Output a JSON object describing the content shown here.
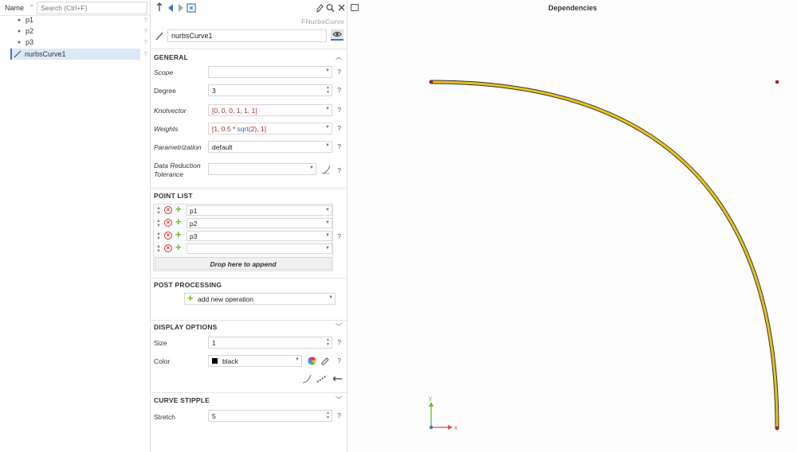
{
  "tree": {
    "name_header": "Name",
    "search_placeholder": "Search (Ctrl+F)",
    "items": [
      {
        "label": "p1",
        "help": "?"
      },
      {
        "label": "p2",
        "help": "?"
      },
      {
        "label": "p3",
        "help": "?"
      },
      {
        "label": "nurbsCurve1",
        "help": "?"
      }
    ]
  },
  "properties": {
    "class_name": "FNurbsCurve",
    "object_name": "nurbsCurve1",
    "general": {
      "title": "GENERAL",
      "scope_label": "Scope",
      "scope_value": "",
      "degree_label": "Degree",
      "degree_value": "3",
      "knotvector_label": "Knotvector",
      "knotvector_value": "[0, 0, 0, 1, 1, 1]",
      "weights_label": "Weights",
      "weights_prefix": "[1, 0.5 * ",
      "weights_fn": "sqrt",
      "weights_suffix": "(2), 1]",
      "param_label": "Parametrization",
      "param_value": "default",
      "tol_label_1": "Data Reduction",
      "tol_label_2": "Tolerance",
      "tol_value": ""
    },
    "point_list": {
      "title": "POINT LIST",
      "items": [
        "p1",
        "p2",
        "p3",
        ""
      ],
      "drop_label": "Drop here to append"
    },
    "post_processing": {
      "title": "POST PROCESSING",
      "add_label": "add new operation"
    },
    "display": {
      "title": "DISPLAY OPTIONS",
      "size_label": "Size",
      "size_value": "1",
      "color_label": "Color",
      "color_value": "black",
      "color_hex": "#000000"
    },
    "stipple": {
      "title": "CURVE STIPPLE",
      "stretch_label": "Stretch",
      "stretch_value": "5"
    }
  },
  "viewport": {
    "title": "Dependencies",
    "curve_color": "#e8c21c",
    "point_color": "#b02020",
    "axis_x_label": "x",
    "axis_y_label": "y"
  }
}
